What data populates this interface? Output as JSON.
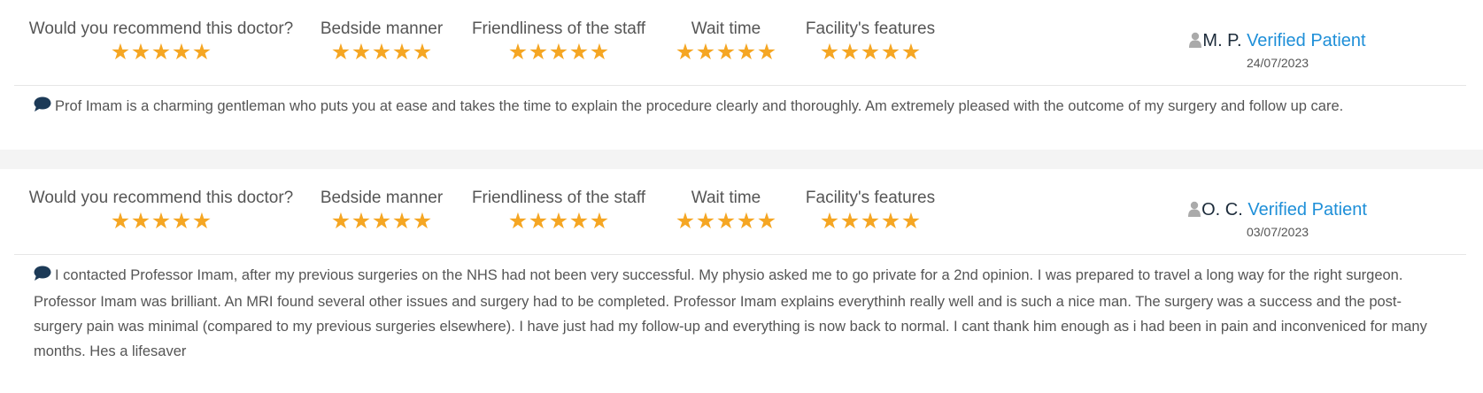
{
  "rating_labels": [
    "Would you recommend this doctor?",
    "Bedside manner",
    "Friendliness of the staff",
    "Wait time",
    "Facility's features"
  ],
  "star_color": "#f5a623",
  "verified_color": "#1e8fd8",
  "reviews": [
    {
      "ratings": [
        5,
        5,
        5,
        5,
        5
      ],
      "initials": "M. P.",
      "verified_label": "Verified Patient",
      "date": "24/07/2023",
      "comment": "Prof Imam is a charming gentleman who puts you at ease and takes the time to explain the procedure clearly and thoroughly. Am extremely pleased with the outcome of my surgery and follow up care."
    },
    {
      "ratings": [
        5,
        5,
        5,
        5,
        5
      ],
      "initials": "O. C.",
      "verified_label": "Verified Patient",
      "date": "03/07/2023",
      "comment": "I contacted Professor Imam, after my previous surgeries on the NHS had not been very successful. My physio asked me to go private for a 2nd opinion. I was prepared to travel a long way for the right surgeon. Professor Imam was brilliant. An MRI found several other issues and surgery had to be completed. Professor Imam explains everythinh really well and is such a nice man. The surgery was a success and the post-surgery pain was minimal (compared to my previous surgeries elsewhere). I have just had my follow-up and everything is now back to normal. I cant thank him enough as i had been in pain and inconveniced for many months. Hes a lifesaver"
    }
  ]
}
